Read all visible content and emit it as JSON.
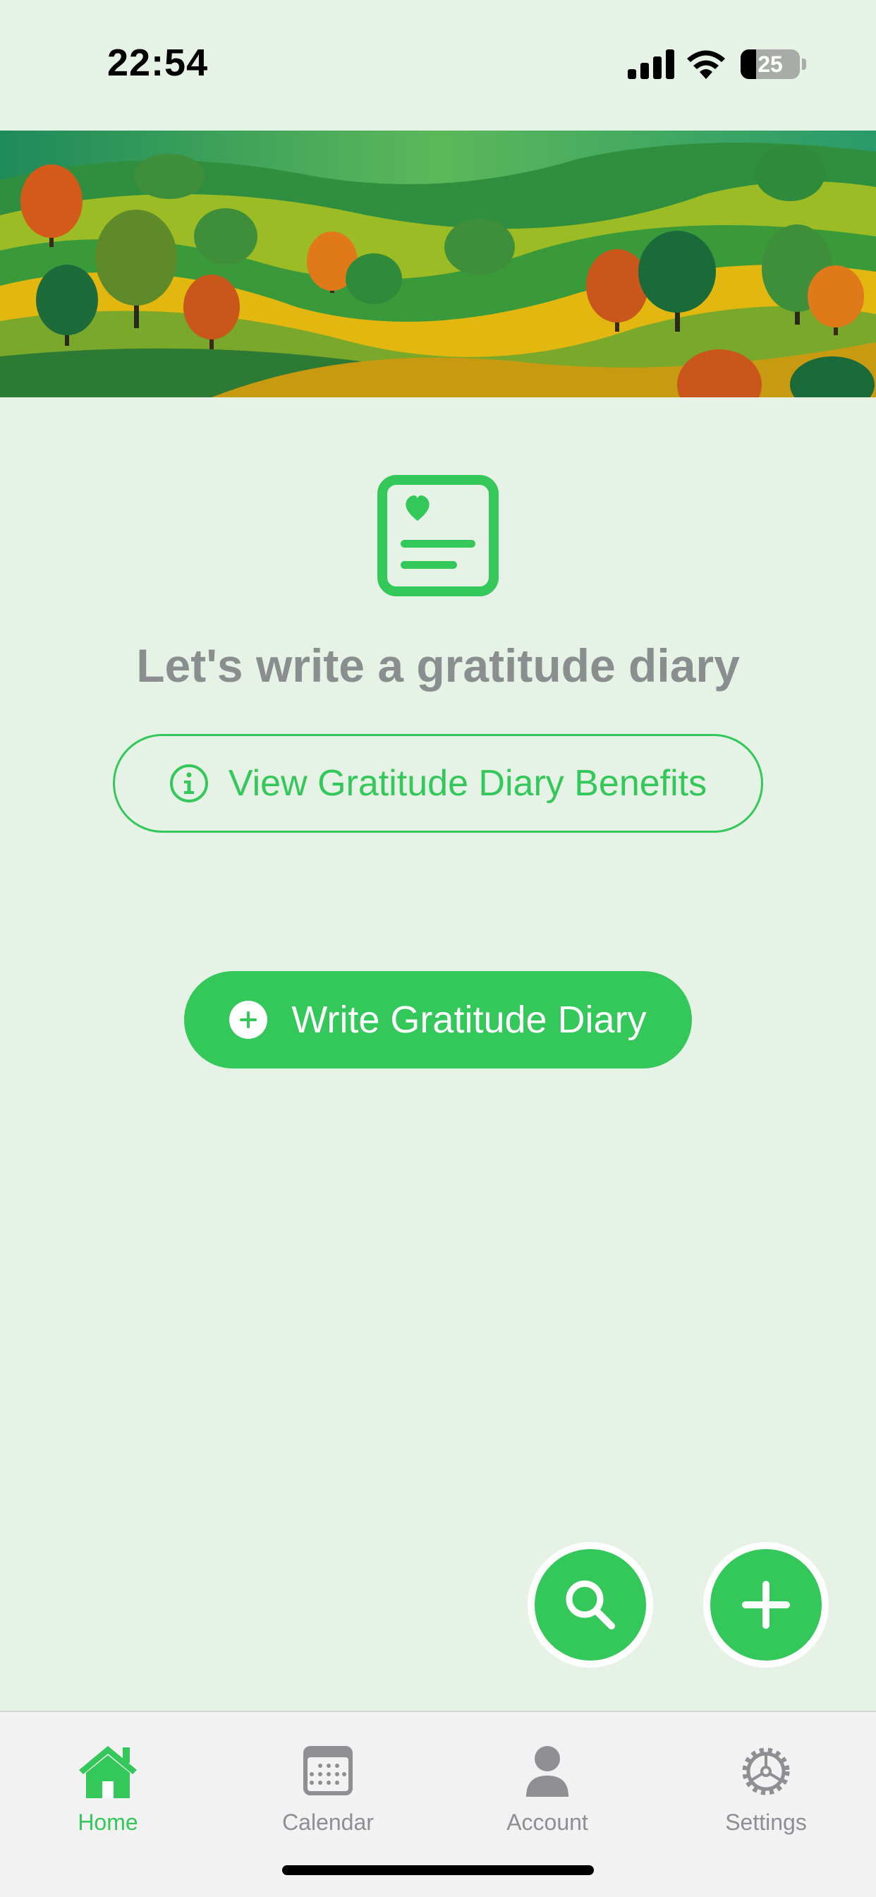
{
  "status_bar": {
    "time": "22:54",
    "battery_level": "25",
    "icons": [
      "cellular-signal-icon",
      "wifi-icon",
      "battery-icon"
    ]
  },
  "banner": {
    "image": "rolling-hills-trees-illustration"
  },
  "main": {
    "icon": "diary-heart-icon",
    "headline": "Let's write a gratitude diary",
    "benefits_button_label": "View Gratitude Diary Benefits",
    "write_button_label": "Write Gratitude Diary"
  },
  "fabs": {
    "search_icon": "search-icon",
    "add_icon": "plus-icon"
  },
  "tab_bar": {
    "items": [
      {
        "label": "Home",
        "icon": "home-icon",
        "active": true
      },
      {
        "label": "Calendar",
        "icon": "calendar-icon",
        "active": false
      },
      {
        "label": "Account",
        "icon": "account-icon",
        "active": false
      },
      {
        "label": "Settings",
        "icon": "gear-icon",
        "active": false
      }
    ]
  },
  "colors": {
    "accent": "#34c759",
    "background": "#e6f2e6",
    "headline_gray": "#8b8e8f",
    "inactive_tab": "#8e8e93",
    "tab_bar_bg": "#f2f2f2"
  }
}
